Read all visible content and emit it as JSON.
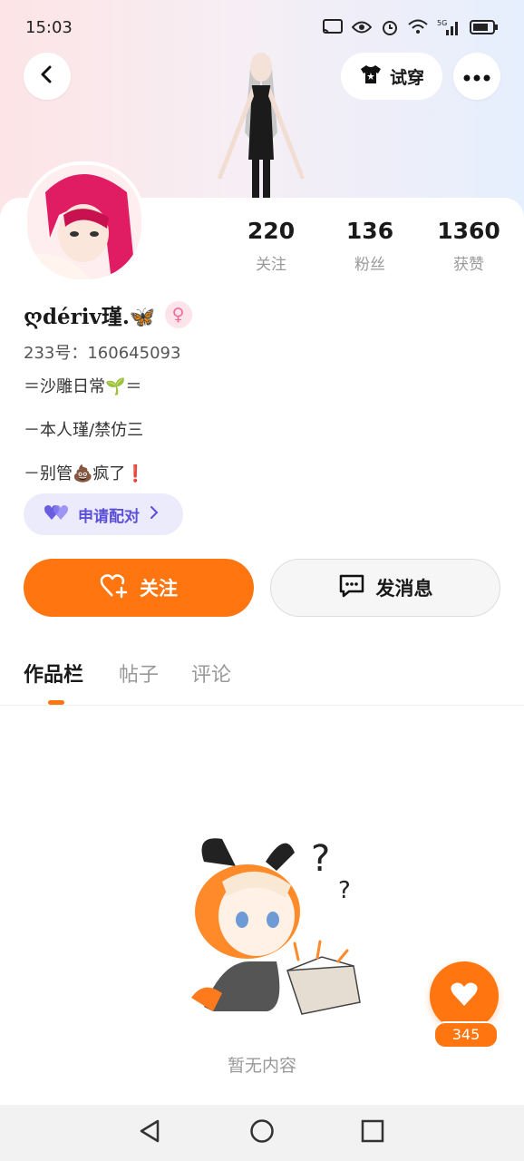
{
  "status_bar": {
    "time": "15:03",
    "icons": [
      "cast-icon",
      "eye-icon",
      "alarm-icon",
      "wifi-icon",
      "signal-5g-icon",
      "battery-icon"
    ]
  },
  "header": {
    "try_on_label": "试穿",
    "icons": [
      "back-icon",
      "tshirt-icon",
      "more-icon"
    ]
  },
  "profile": {
    "name": "ღdériv瑾.🦋",
    "gender_symbol": "♀",
    "uid": "233号：160645093",
    "bio": [
      "＝沙雕日常🌱＝",
      "－本人瑾/禁仿三",
      "－别管💩疯了❗"
    ]
  },
  "stats": [
    {
      "value": "220",
      "label": "关注"
    },
    {
      "value": "136",
      "label": "粉丝"
    },
    {
      "value": "1360",
      "label": "获赞"
    }
  ],
  "match_button": {
    "label": "申请配对"
  },
  "actions": {
    "follow_label": "关注",
    "message_label": "发消息"
  },
  "tabs": [
    {
      "label": "作品栏",
      "active": true
    },
    {
      "label": "帖子",
      "active": false
    },
    {
      "label": "评论",
      "active": false
    }
  ],
  "empty_state": {
    "text": "暂无内容"
  },
  "like_fab": {
    "count": "345"
  },
  "colors": {
    "accent": "#ff7510",
    "match": "#5b4fd6",
    "match_bg": "#ecebfc",
    "gender_pink": "#ef6a9a"
  }
}
